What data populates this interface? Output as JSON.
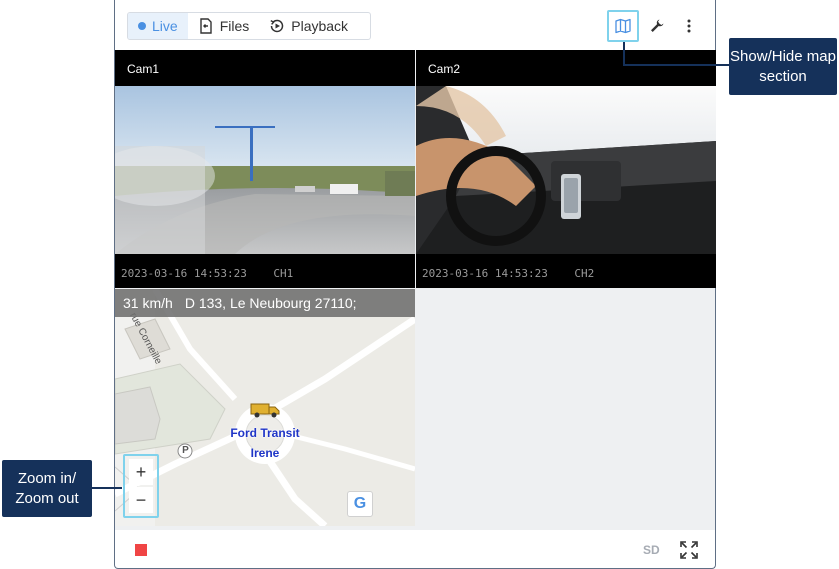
{
  "tabs": [
    {
      "label": "Live",
      "active": true
    },
    {
      "label": "Files",
      "active": false
    },
    {
      "label": "Playback",
      "active": false
    }
  ],
  "toolbar": {
    "map_icon": "map-icon",
    "settings_icon": "wrench-icon",
    "more_icon": "more-vertical-icon"
  },
  "cameras": [
    {
      "title": "Cam1",
      "stamp": "2023-03-16 14:53:23    CH1"
    },
    {
      "title": "Cam2",
      "stamp": "2023-03-16 14:53:23    CH2"
    }
  ],
  "map": {
    "speed": "31 km/h",
    "address": "D 133, Le Neubourg 27110;",
    "street_label": "rue Corneille",
    "vehicle_name": "Ford Transit",
    "driver_name": "Irene",
    "parking_label": "P",
    "zoom_in": "+",
    "zoom_out": "−",
    "google_label": "G"
  },
  "bottom": {
    "quality": "SD"
  },
  "callouts": {
    "map_toggle": "Show/Hide map section",
    "zoom": "Zoom in/ Zoom out"
  },
  "colors": {
    "accent": "#4a90e2",
    "callout": "#15315a",
    "highlight": "#7fd2ec",
    "record": "#f04545"
  }
}
